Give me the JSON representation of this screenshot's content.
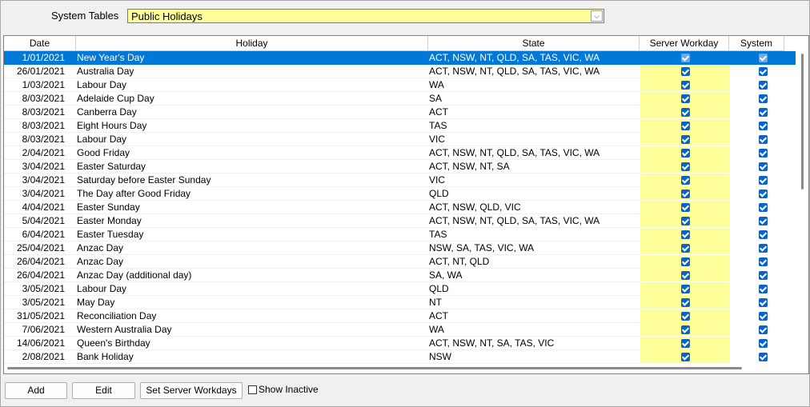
{
  "top": {
    "label": "System Tables",
    "selected": "Public Holidays"
  },
  "columns": [
    "Date",
    "Holiday",
    "State",
    "Server Workday",
    "System"
  ],
  "rows": [
    {
      "date": "1/01/2021",
      "holiday": "New Year's Day",
      "state": "ACT, NSW, NT, QLD, SA, TAS, VIC, WA"
    },
    {
      "date": "26/01/2021",
      "holiday": "Australia Day",
      "state": "ACT, NSW, NT, QLD, SA, TAS, VIC, WA"
    },
    {
      "date": "1/03/2021",
      "holiday": "Labour Day",
      "state": "WA"
    },
    {
      "date": "8/03/2021",
      "holiday": "Adelaide Cup Day",
      "state": "SA"
    },
    {
      "date": "8/03/2021",
      "holiday": "Canberra Day",
      "state": "ACT"
    },
    {
      "date": "8/03/2021",
      "holiday": "Eight Hours Day",
      "state": "TAS"
    },
    {
      "date": "8/03/2021",
      "holiday": "Labour Day",
      "state": "VIC"
    },
    {
      "date": "2/04/2021",
      "holiday": "Good Friday",
      "state": "ACT, NSW, NT, QLD, SA, TAS, VIC, WA"
    },
    {
      "date": "3/04/2021",
      "holiday": "Easter Saturday",
      "state": "ACT, NSW, NT, SA"
    },
    {
      "date": "3/04/2021",
      "holiday": "Saturday before Easter Sunday",
      "state": "VIC"
    },
    {
      "date": "3/04/2021",
      "holiday": "The Day after Good Friday",
      "state": "QLD"
    },
    {
      "date": "4/04/2021",
      "holiday": "Easter Sunday",
      "state": "ACT, NSW, QLD, VIC"
    },
    {
      "date": "5/04/2021",
      "holiday": "Easter Monday",
      "state": "ACT, NSW, NT, QLD, SA, TAS, VIC, WA"
    },
    {
      "date": "6/04/2021",
      "holiday": "Easter Tuesday",
      "state": "TAS"
    },
    {
      "date": "25/04/2021",
      "holiday": "Anzac Day",
      "state": "NSW, SA, TAS, VIC, WA"
    },
    {
      "date": "26/04/2021",
      "holiday": "Anzac Day",
      "state": "ACT, NT, QLD"
    },
    {
      "date": "26/04/2021",
      "holiday": "Anzac Day (additional day)",
      "state": "SA, WA"
    },
    {
      "date": "3/05/2021",
      "holiday": "Labour Day",
      "state": "QLD"
    },
    {
      "date": "3/05/2021",
      "holiday": "May Day",
      "state": "NT"
    },
    {
      "date": "31/05/2021",
      "holiday": "Reconciliation Day",
      "state": "ACT"
    },
    {
      "date": "7/06/2021",
      "holiday": "Western Australia Day",
      "state": "WA"
    },
    {
      "date": "14/06/2021",
      "holiday": "Queen's Birthday",
      "state": "ACT, NSW, NT, SA, TAS, VIC"
    },
    {
      "date": "2/08/2021",
      "holiday": "Bank Holiday",
      "state": "NSW"
    }
  ],
  "buttons": {
    "add": "Add",
    "edit": "Edit",
    "set_server": "Set Server Workdays",
    "show_inactive": "Show Inactive"
  }
}
